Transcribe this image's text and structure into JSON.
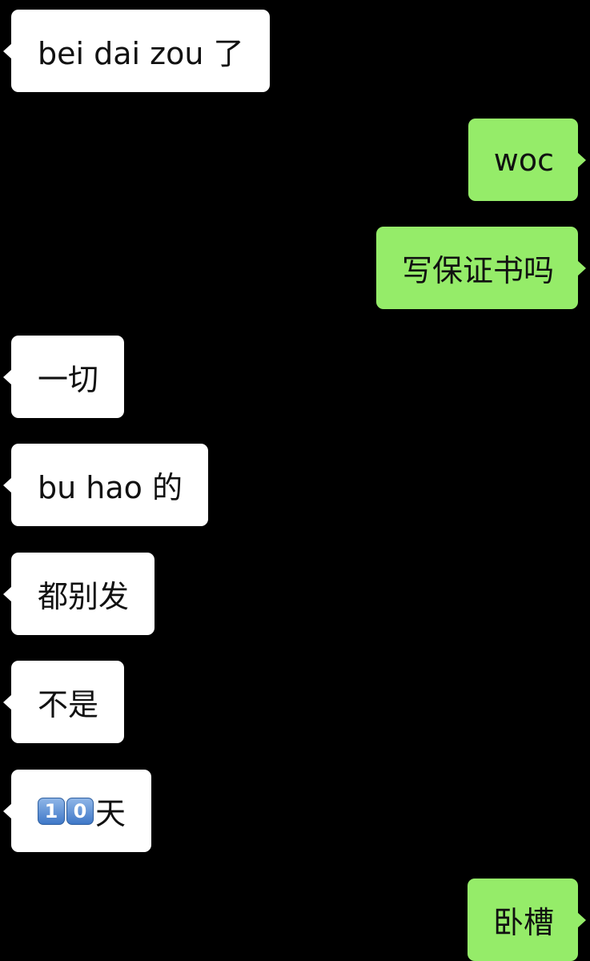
{
  "conversation": {
    "messages": [
      {
        "side": "received",
        "text": "bei dai zou 了"
      },
      {
        "side": "sent",
        "text": "woc"
      },
      {
        "side": "sent",
        "text": "写保证书吗"
      },
      {
        "side": "received",
        "text": "一切"
      },
      {
        "side": "received",
        "text": "bu hao 的"
      },
      {
        "side": "received",
        "text": "都别发"
      },
      {
        "side": "received",
        "text": "不是"
      },
      {
        "side": "received",
        "keycap_1": "1",
        "keycap_2": "0",
        "text": "天"
      },
      {
        "side": "sent",
        "text": "卧槽"
      }
    ]
  },
  "colors": {
    "background": "#000000",
    "received_bubble": "#ffffff",
    "sent_bubble": "#95ec69",
    "text": "#111111"
  },
  "icons": [
    "keycap-1-emoji",
    "keycap-0-emoji"
  ]
}
